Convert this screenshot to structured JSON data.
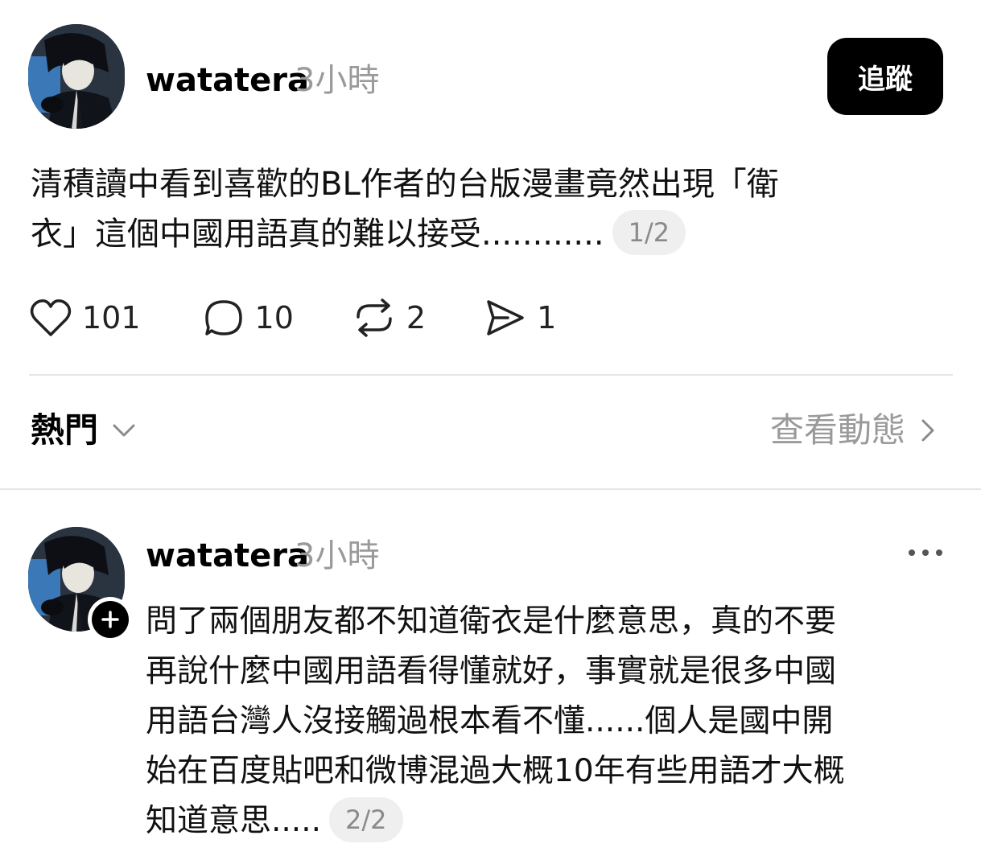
{
  "post1": {
    "username": "watatera",
    "timestamp": "3小時",
    "follow_label": "追蹤",
    "text_lines": [
      "清積讀中看到喜歡的BL作者的台版漫畫竟然出現「衛",
      "衣」這個中國用語真的難以接受............"
    ],
    "page_indicator": "1/2",
    "actions": {
      "likes": "101",
      "comments": "10",
      "reposts": "2",
      "shares": "1"
    }
  },
  "replies_bar": {
    "sort_label": "熱門",
    "view_activity_label": "查看動態"
  },
  "post2": {
    "username": "watatera",
    "timestamp": "3小時",
    "text_lines": [
      "問了兩個朋友都不知道衛衣是什麼意思，真的不要",
      "再說什麼中國用語看得懂就好，事實就是很多中國",
      "用語台灣人沒接觸過根本看不懂......個人是國中開",
      "始在百度貼吧和微博混過大概10年有些用語才大概",
      "知道意思....."
    ],
    "page_indicator": "2/2"
  },
  "icons": {
    "like": "heart-icon",
    "comment": "comment-bubble-icon",
    "repost": "repost-icon",
    "share": "send-icon",
    "sort": "chevron-down-icon",
    "view_activity": "chevron-right-icon",
    "follow": "plus-icon",
    "more": "more-dots-icon"
  }
}
